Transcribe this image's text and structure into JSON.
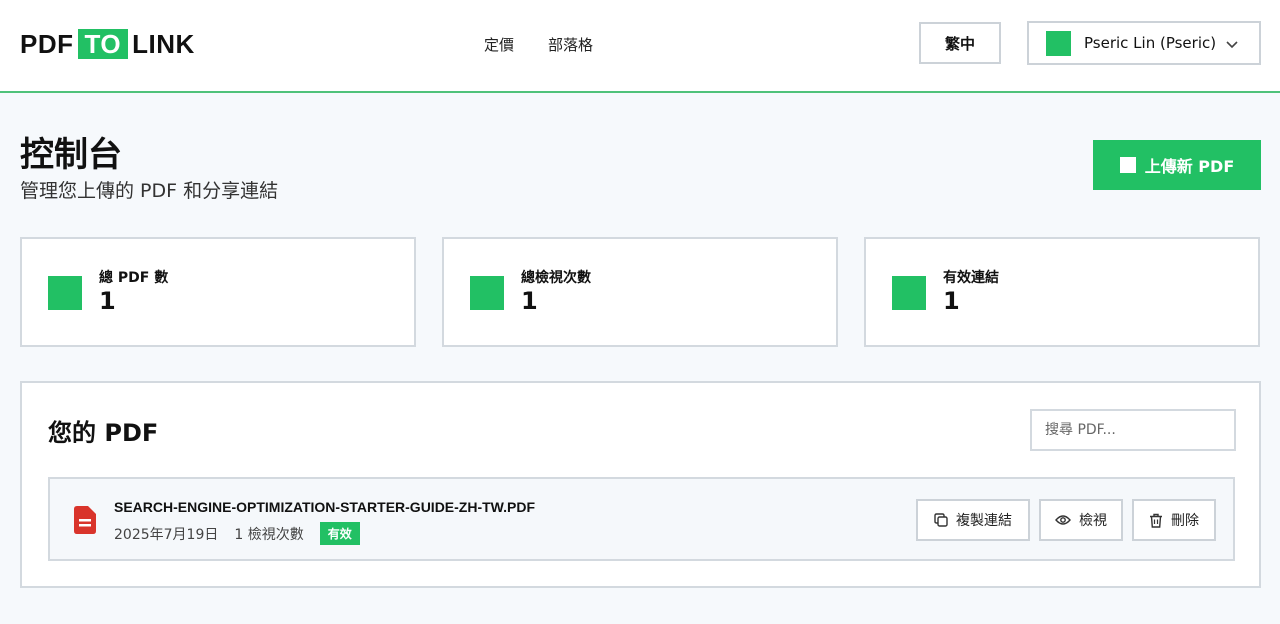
{
  "header": {
    "logo": {
      "left": "PDF",
      "mid": "TO",
      "right": "LINK"
    },
    "nav": [
      "定價",
      "部落格"
    ],
    "language": "繁中",
    "user": {
      "name": "Pseric Lin (Pseric)"
    }
  },
  "page": {
    "title": "控制台",
    "subtitle": "管理您上傳的 PDF 和分享連結",
    "upload_label": "上傳新 PDF"
  },
  "stats": [
    {
      "label": "總 PDF 數",
      "value": "1"
    },
    {
      "label": "總檢視次數",
      "value": "1"
    },
    {
      "label": "有效連結",
      "value": "1"
    }
  ],
  "pdf_panel": {
    "title": "您的 PDF",
    "search_placeholder": "搜尋 PDF...",
    "items": [
      {
        "name": "SEARCH-ENGINE-OPTIMIZATION-STARTER-GUIDE-ZH-TW.PDF",
        "date": "2025年7月19日",
        "views": "1 檢視次數",
        "status": "有效",
        "actions": {
          "copy": "複製連結",
          "view": "檢視",
          "delete": "刪除"
        }
      }
    ]
  },
  "colors": {
    "accent": "#22c064",
    "file_icon": "#d9342b",
    "border": "#d3d9df"
  },
  "icons": [
    "chevron-down-icon",
    "file-icon",
    "copy-icon",
    "eye-icon",
    "trash-icon"
  ]
}
